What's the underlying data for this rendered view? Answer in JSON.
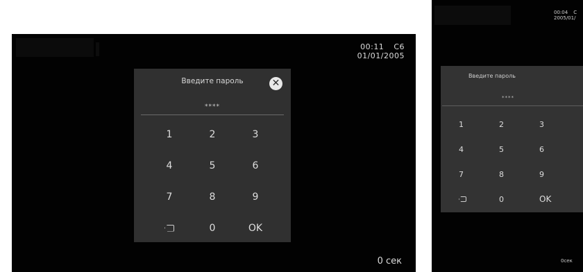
{
  "screen_a": {
    "clock": {
      "time": "00:11",
      "day": "C6",
      "date": "01/01/2005"
    },
    "timer": "0 сек",
    "dialog": {
      "title": "Введите пароль",
      "password_mask": "****",
      "close_icon": "close-icon",
      "keys": [
        "1",
        "2",
        "3",
        "4",
        "5",
        "6",
        "7",
        "8",
        "9",
        "backspace",
        "0",
        "OK"
      ]
    }
  },
  "screen_b": {
    "clock": {
      "time": "00:04",
      "day": "C",
      "date": "2005/01/"
    },
    "timer": "0сек",
    "dialog": {
      "title": "Введите пароль",
      "password_mask": "****",
      "keys": [
        "1",
        "2",
        "3",
        "4",
        "5",
        "6",
        "7",
        "8",
        "9",
        "backspace",
        "0",
        "OK"
      ]
    }
  },
  "colors": {
    "screen_bg": "#020202",
    "dialog_bg": "#303030",
    "text": "#dedede"
  }
}
